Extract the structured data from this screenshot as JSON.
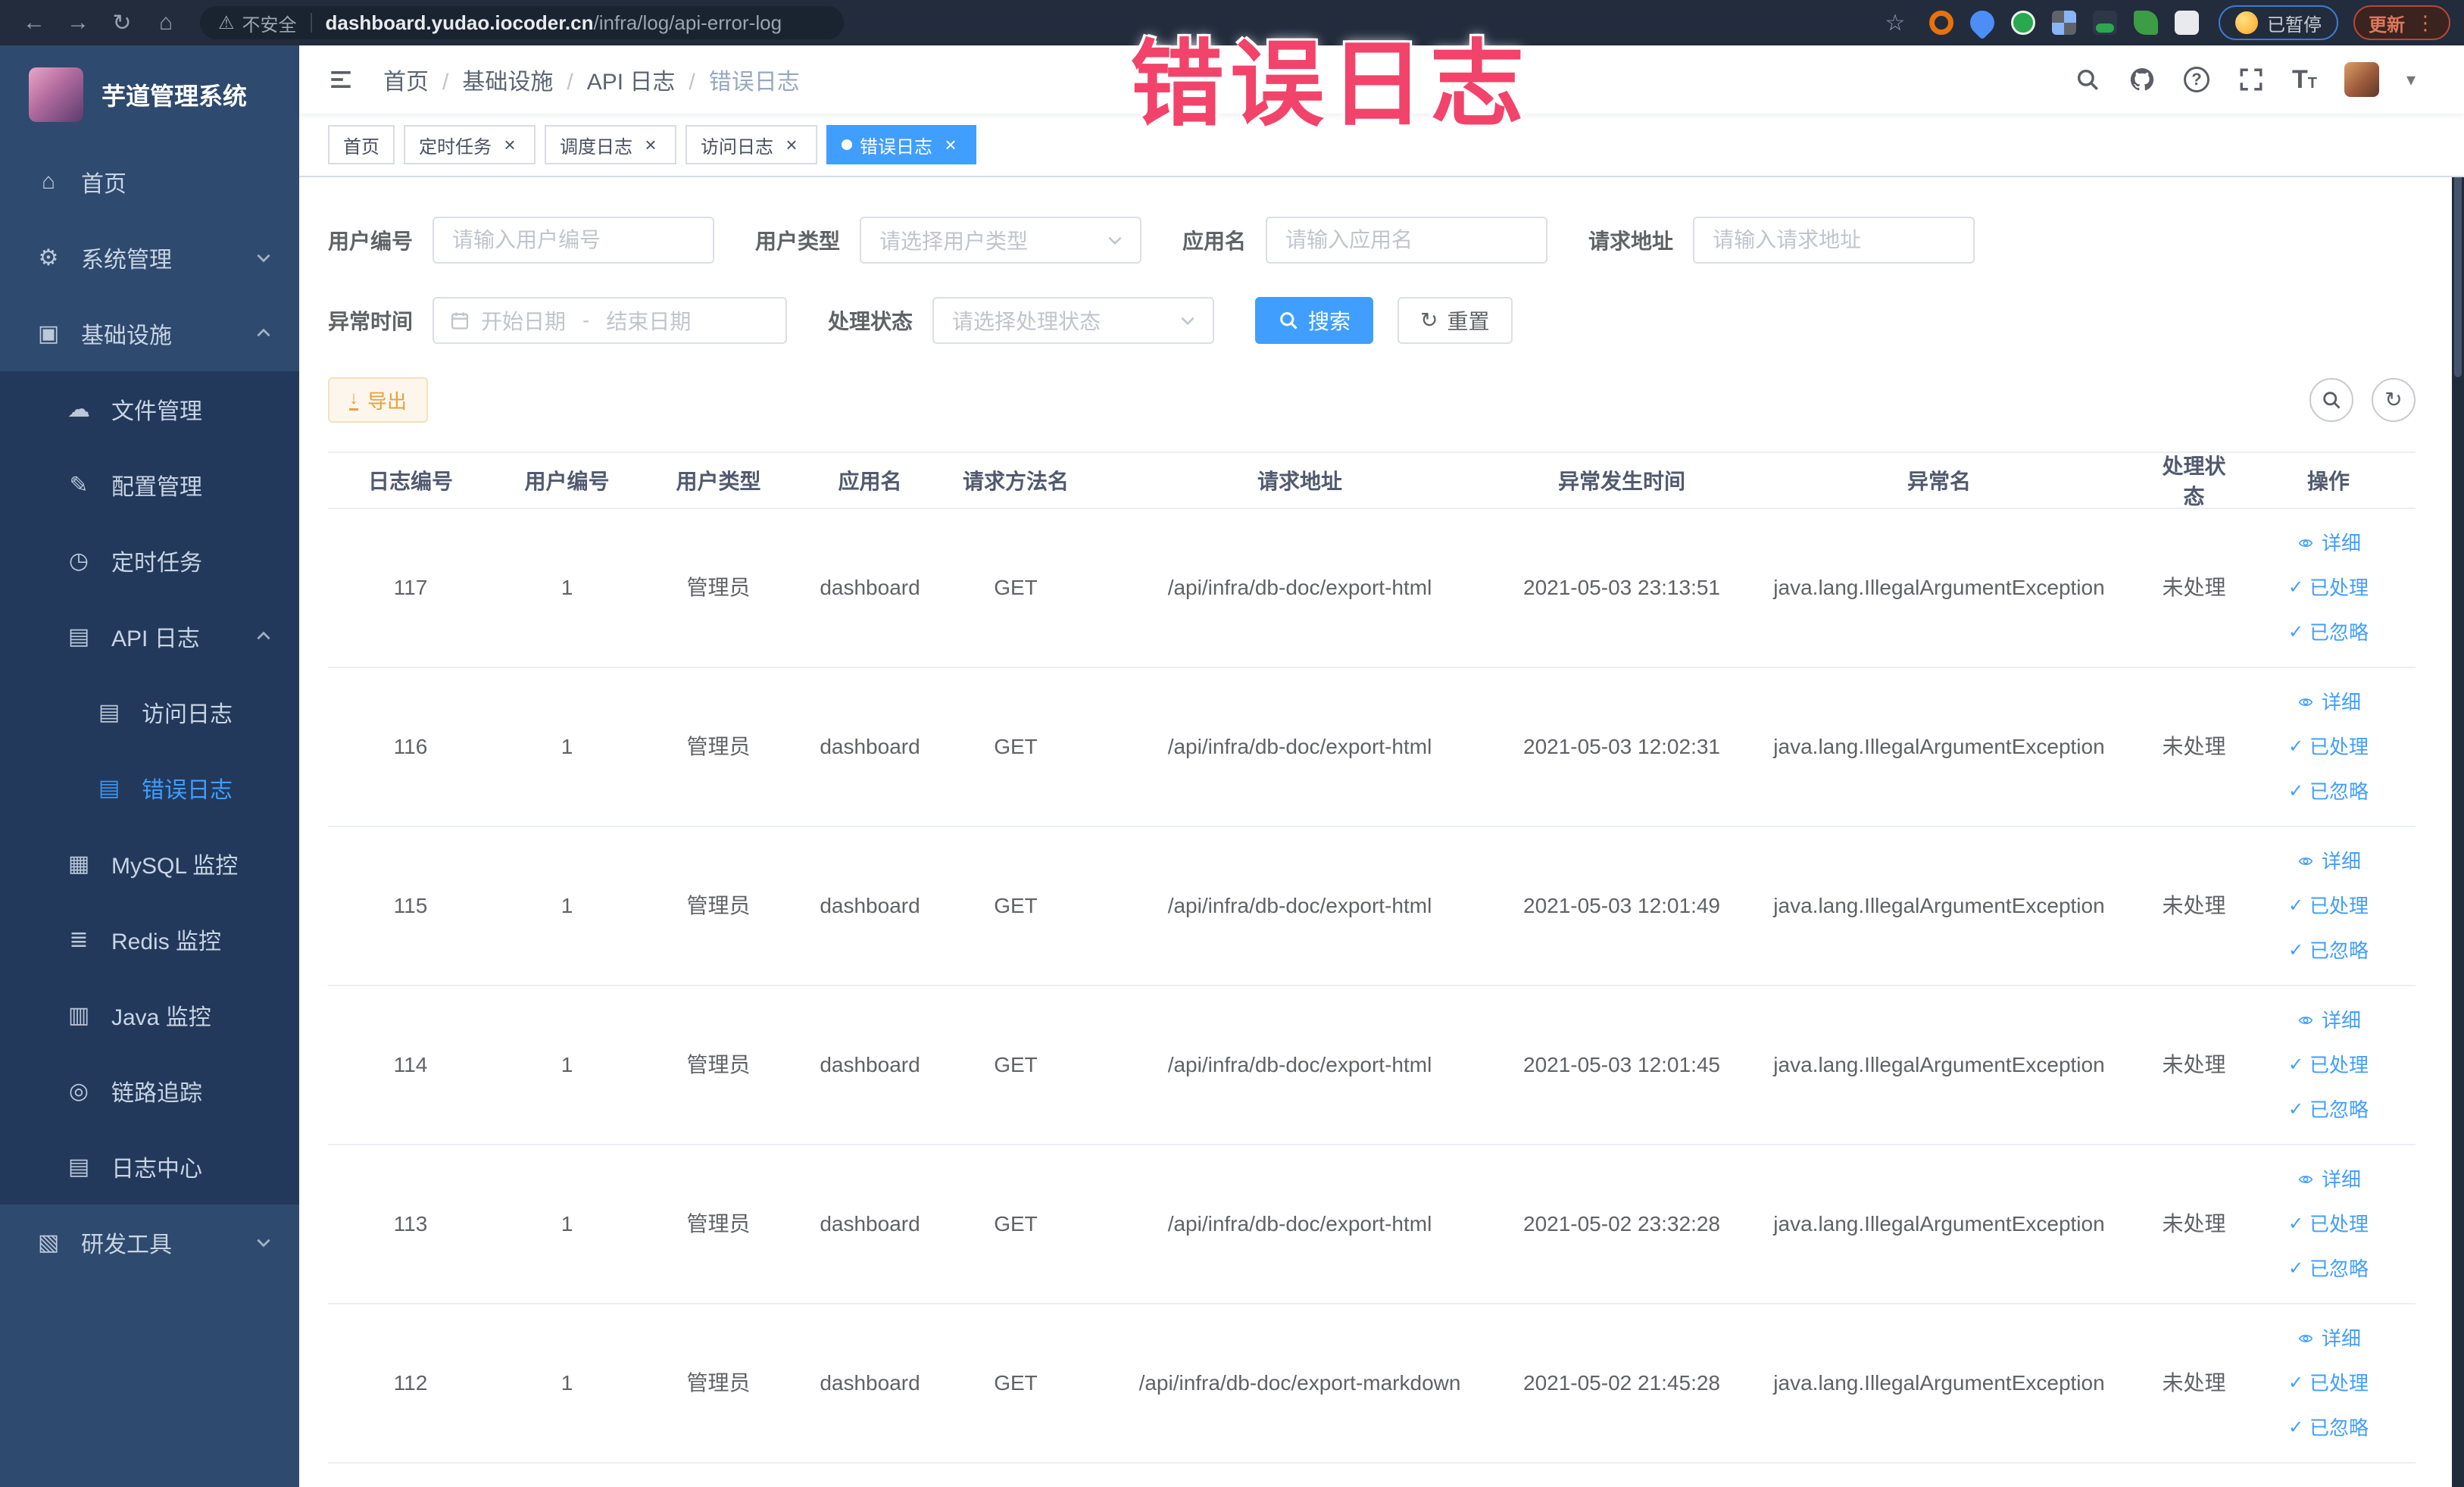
{
  "browser": {
    "nav_icons": [
      "back-icon",
      "forward-icon",
      "reload-icon",
      "home-icon"
    ],
    "security_label": "不安全",
    "url_domain": "dashboard.yudao.iocoder.cn",
    "url_path": "/infra/log/api-error-log",
    "paused_badge": "已暂停",
    "update_button": "更新"
  },
  "annotation": {
    "text": "错误日志",
    "color": "#f2436b"
  },
  "sidebar": {
    "title": "芋道管理系统",
    "items": [
      {
        "label": "首页",
        "icon": "home-icon",
        "indent": 1
      },
      {
        "label": "系统管理",
        "icon": "gear-icon",
        "indent": 1,
        "arrow": "down"
      },
      {
        "label": "基础设施",
        "icon": "monitor-icon",
        "indent": 1,
        "arrow": "up"
      },
      {
        "label": "文件管理",
        "icon": "cloud-upload-icon",
        "indent": 2,
        "sub": true
      },
      {
        "label": "配置管理",
        "icon": "edit-icon",
        "indent": 2,
        "sub": true
      },
      {
        "label": "定时任务",
        "icon": "timer-icon",
        "indent": 2,
        "sub": true
      },
      {
        "label": "API 日志",
        "icon": "log-icon",
        "indent": 2,
        "sub": true,
        "arrow": "up"
      },
      {
        "label": "访问日志",
        "icon": "log-icon",
        "indent": 3,
        "sub": true
      },
      {
        "label": "错误日志",
        "icon": "log-icon",
        "indent": 3,
        "sub": true,
        "active": true
      },
      {
        "label": "MySQL 监控",
        "icon": "chart-icon",
        "indent": 2,
        "sub": true
      },
      {
        "label": "Redis 监控",
        "icon": "layers-icon",
        "indent": 2,
        "sub": true
      },
      {
        "label": "Java 监控",
        "icon": "java-monitor-icon",
        "indent": 2,
        "sub": true
      },
      {
        "label": "链路追踪",
        "icon": "eye-icon",
        "indent": 2,
        "sub": true
      },
      {
        "label": "日志中心",
        "icon": "doc-icon",
        "indent": 2,
        "sub": true
      },
      {
        "label": "研发工具",
        "icon": "toolbox-icon",
        "indent": 1,
        "arrow": "down"
      }
    ]
  },
  "breadcrumb": [
    "首页",
    "基础设施",
    "API 日志",
    "错误日志"
  ],
  "tabs": [
    {
      "label": "首页",
      "closable": false,
      "active": false
    },
    {
      "label": "定时任务",
      "closable": true,
      "active": false
    },
    {
      "label": "调度日志",
      "closable": true,
      "active": false
    },
    {
      "label": "访问日志",
      "closable": true,
      "active": false
    },
    {
      "label": "错误日志",
      "closable": true,
      "active": true
    }
  ],
  "filters": {
    "user_id": {
      "label": "用户编号",
      "placeholder": "请输入用户编号"
    },
    "user_type": {
      "label": "用户类型",
      "placeholder": "请选择用户类型"
    },
    "app_name": {
      "label": "应用名",
      "placeholder": "请输入应用名"
    },
    "request_url": {
      "label": "请求地址",
      "placeholder": "请输入请求地址"
    },
    "exception_time": {
      "label": "异常时间",
      "start_placeholder": "开始日期",
      "separator": "-",
      "end_placeholder": "结束日期"
    },
    "process_status": {
      "label": "处理状态",
      "placeholder": "请选择处理状态"
    },
    "search_label": "搜索",
    "reset_label": "重置"
  },
  "toolbar": {
    "export_label": "导出"
  },
  "table": {
    "columns": [
      "日志编号",
      "用户编号",
      "用户类型",
      "应用名",
      "请求方法名",
      "请求地址",
      "异常发生时间",
      "异常名",
      "处理状态",
      "操作"
    ],
    "rows": [
      {
        "id": "117",
        "user_id": "1",
        "user_type": "管理员",
        "app": "dashboard",
        "method": "GET",
        "url": "/api/infra/db-doc/export-html",
        "time": "2021-05-03 23:13:51",
        "exception": "java.lang.IllegalArgumentException",
        "status": "未处理"
      },
      {
        "id": "116",
        "user_id": "1",
        "user_type": "管理员",
        "app": "dashboard",
        "method": "GET",
        "url": "/api/infra/db-doc/export-html",
        "time": "2021-05-03 12:02:31",
        "exception": "java.lang.IllegalArgumentException",
        "status": "未处理"
      },
      {
        "id": "115",
        "user_id": "1",
        "user_type": "管理员",
        "app": "dashboard",
        "method": "GET",
        "url": "/api/infra/db-doc/export-html",
        "time": "2021-05-03 12:01:49",
        "exception": "java.lang.IllegalArgumentException",
        "status": "未处理"
      },
      {
        "id": "114",
        "user_id": "1",
        "user_type": "管理员",
        "app": "dashboard",
        "method": "GET",
        "url": "/api/infra/db-doc/export-html",
        "time": "2021-05-03 12:01:45",
        "exception": "java.lang.IllegalArgumentException",
        "status": "未处理"
      },
      {
        "id": "113",
        "user_id": "1",
        "user_type": "管理员",
        "app": "dashboard",
        "method": "GET",
        "url": "/api/infra/db-doc/export-html",
        "time": "2021-05-02 23:32:28",
        "exception": "java.lang.IllegalArgumentException",
        "status": "未处理"
      },
      {
        "id": "112",
        "user_id": "1",
        "user_type": "管理员",
        "app": "dashboard",
        "method": "GET",
        "url": "/api/infra/db-doc/export-markdown",
        "time": "2021-05-02 21:45:28",
        "exception": "java.lang.IllegalArgumentException",
        "status": "未处理"
      }
    ],
    "actions": {
      "detail": "详细",
      "processed": "已处理",
      "ignored": "已忽略"
    }
  },
  "colors": {
    "accent": "#409eff",
    "warning": "#e6a23c",
    "sidebar_bg": "#2e4a6e",
    "submenu_bg": "#22395b",
    "browser_bg": "#222c3d"
  }
}
